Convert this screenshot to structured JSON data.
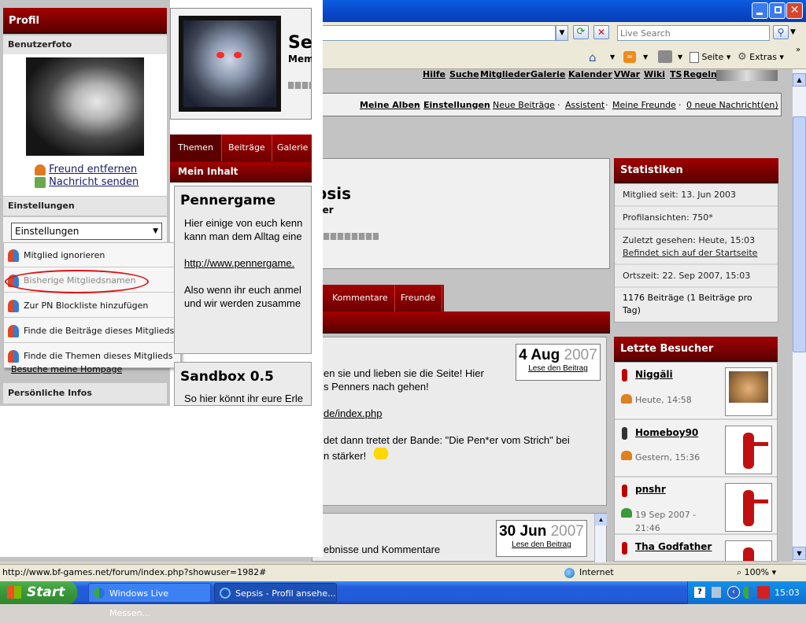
{
  "browser": {
    "live_search_placeholder": "Live Search",
    "toolbar_page": "Seite",
    "toolbar_extras": "Extras",
    "status_url": "http://www.bf-games.net/forum/index.php?showuser=1982#",
    "zone": "Internet",
    "zoom": "100%"
  },
  "site": {
    "topnav": [
      "Hilfe",
      "Suche",
      "Mitglieder",
      "Galerie",
      "Kalender",
      "VWar",
      "Wiki",
      "TS",
      "Regeln"
    ],
    "usernav": [
      "Meine Alben",
      "Einstellungen",
      "Neue Beiträge",
      "Assistent",
      "Meine Freunde",
      "0 neue Nachricht(en)"
    ]
  },
  "profile": {
    "sidebar_title": "Profil",
    "photo_label": "Benutzerfoto",
    "friend_remove": "Freund entfernen",
    "send_message": "Nachricht senden",
    "settings_label": "Einstellungen",
    "settings_select": "Einstellungen",
    "menu_items": [
      "Mitglied ignorieren",
      "Bisherige Mitgliedsnamen",
      "Zur PN Blockliste hinzufügen",
      "Finde die Beiträge dieses Mitglieds",
      "Finde die Themen dieses Mitglieds"
    ],
    "homepage_link": "Besuche meine Hompage",
    "personal_info": "Persönliche Infos",
    "name_short": "Sep",
    "name_suffix": "psis",
    "role_short": "Mem",
    "role_suffix": "ber"
  },
  "tabs_top": [
    "Themen",
    "Beiträge",
    "Galerie"
  ],
  "tabs_mid": [
    "Kommentare",
    "Freunde"
  ],
  "content": {
    "mein_inhalt": "Mein Inhalt",
    "post1_title": "Pennergame",
    "post1_line1": "Hier einige von euch kenn",
    "post1_line2": "kann man dem Alltag eine",
    "post1_link": "http://www.pennergame.",
    "post1_line3": "Also wenn ihr euch anmel",
    "post1_line4": "und wir werden zusamme",
    "post1_cont1": "en sie und lieben sie die Seite! Hier",
    "post1_cont2": "s Penners nach gehen!",
    "post1_cont3": "de/index.php",
    "post1_cont4": "det dann tretet der Bande: \"Die Pen*er vom Strich\" bei",
    "post1_cont5": "n stärker!",
    "date1_day": "4 Aug",
    "date1_year": "2007",
    "date1_link": "Lese den Beitrag",
    "post2_title": "Sandbox 0.5",
    "post2_line1": "So hier könnt ihr eure Erle",
    "post2_cont1": "ebnisse und Kommentare",
    "date2_day": "30 Jun",
    "date2_year": "2007",
    "date2_link": "Lese den Beitrag"
  },
  "stats": {
    "title": "Statistiken",
    "member_since": "Mitglied seit: 13. Jun 2003",
    "profile_views": "Profilansichten: 750*",
    "last_seen": "Zuletzt gesehen: Heute, 15:03",
    "location": "Befindet sich auf der Startseite",
    "local_time": "Ortszeit: 22. Sep 2007, 15:03",
    "posts": "1176 Beiträge (1 Beiträge pro Tag)"
  },
  "visitors": {
    "title": "Letzte Besucher",
    "list": [
      {
        "name": "Niggäli",
        "time": "Heute, 14:58"
      },
      {
        "name": "Homeboy90",
        "time": "Gestern, 15:36"
      },
      {
        "name": "pnshr",
        "time": "19 Sep 2007 - 21:46"
      },
      {
        "name": "Tha Godfather",
        "time": ""
      }
    ]
  },
  "taskbar": {
    "start": "Start",
    "task1": "Windows Live Messen...",
    "task2": "Sepsis - Profil ansehe...",
    "clock": "15:03"
  }
}
